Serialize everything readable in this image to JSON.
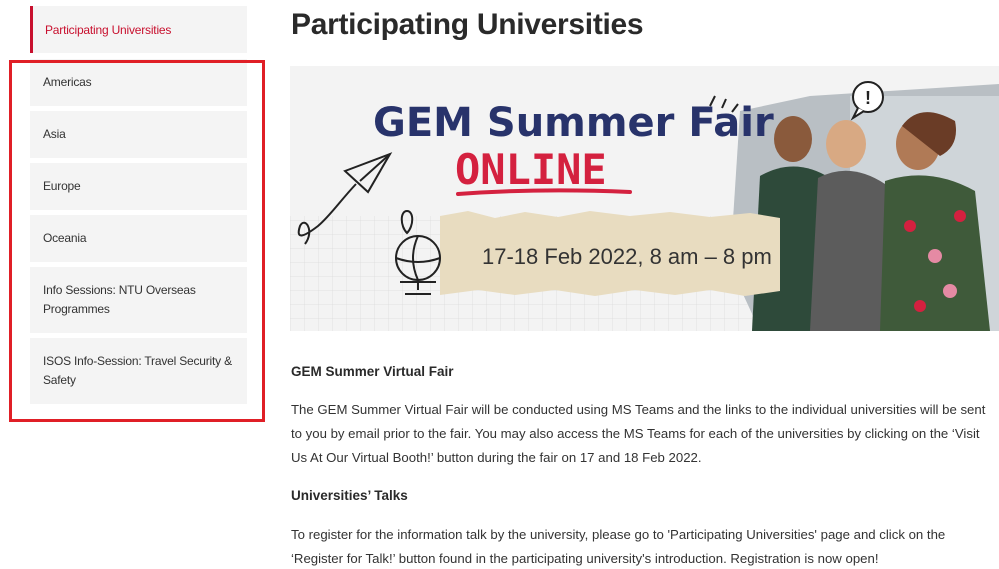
{
  "sidebar": {
    "active": "Participating Universities",
    "items": [
      {
        "label": "Americas"
      },
      {
        "label": "Asia"
      },
      {
        "label": "Europe"
      },
      {
        "label": "Oceania"
      },
      {
        "label": "Info Sessions: NTU Overseas Programmes"
      },
      {
        "label": "ISOS Info-Session: Travel Security & Safety"
      }
    ]
  },
  "main": {
    "title": "Participating Universities",
    "banner": {
      "headline": "GEM Summer Fair",
      "subheadline": "ONLINE",
      "dates": "17-18 Feb 2022, 8 am – 8 pm",
      "exclaim": "!"
    },
    "section1": {
      "heading": "GEM Summer Virtual Fair",
      "text": "The GEM Summer Virtual Fair will be conducted using MS Teams and the links to the individual universities will be sent to you by email prior to the fair. You may also access the MS Teams for each of the universities by clicking on the ‘Visit Us At Our Virtual Booth!’ button during the fair on 17 and 18 Feb 2022."
    },
    "section2": {
      "heading": "Universities’ Talks",
      "text": "To register for the information talk by the university, please go to 'Participating Universities' page and click on the ‘Register for Talk!’ button found in the participating university's introduction. Registration is now open!"
    }
  },
  "colors": {
    "accent": "#c8102e",
    "highlight_box": "#e01f26",
    "banner_navy": "#28336b",
    "banner_red": "#d4213f",
    "sidebar_bg": "#f4f4f4"
  }
}
